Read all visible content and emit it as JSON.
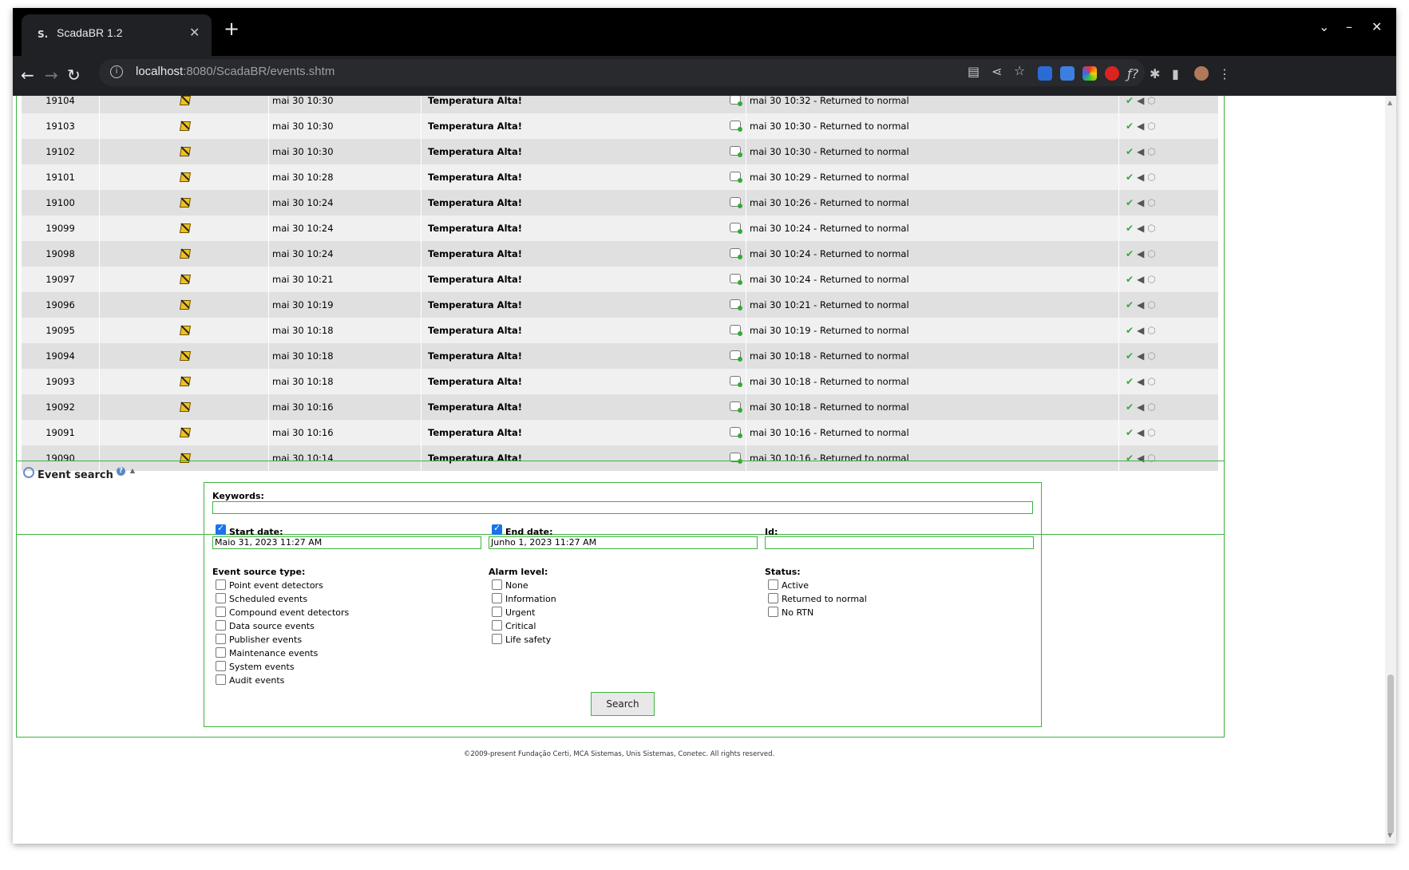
{
  "browser": {
    "tab_title": "ScadaBR 1.2",
    "tab_favicon": "S.",
    "url_host": "localhost",
    "url_path": ":8080/ScadaBR/events.shtm"
  },
  "events_table": {
    "rows": [
      {
        "id": "19104",
        "time": "mai 30 10:30",
        "message": "Temperatura Alta!",
        "rtn": "mai 30 10:32 - Returned to normal"
      },
      {
        "id": "19103",
        "time": "mai 30 10:30",
        "message": "Temperatura Alta!",
        "rtn": "mai 30 10:30 - Returned to normal"
      },
      {
        "id": "19102",
        "time": "mai 30 10:30",
        "message": "Temperatura Alta!",
        "rtn": "mai 30 10:30 - Returned to normal"
      },
      {
        "id": "19101",
        "time": "mai 30 10:28",
        "message": "Temperatura Alta!",
        "rtn": "mai 30 10:29 - Returned to normal"
      },
      {
        "id": "19100",
        "time": "mai 30 10:24",
        "message": "Temperatura Alta!",
        "rtn": "mai 30 10:26 - Returned to normal"
      },
      {
        "id": "19099",
        "time": "mai 30 10:24",
        "message": "Temperatura Alta!",
        "rtn": "mai 30 10:24 - Returned to normal"
      },
      {
        "id": "19098",
        "time": "mai 30 10:24",
        "message": "Temperatura Alta!",
        "rtn": "mai 30 10:24 - Returned to normal"
      },
      {
        "id": "19097",
        "time": "mai 30 10:21",
        "message": "Temperatura Alta!",
        "rtn": "mai 30 10:24 - Returned to normal"
      },
      {
        "id": "19096",
        "time": "mai 30 10:19",
        "message": "Temperatura Alta!",
        "rtn": "mai 30 10:21 - Returned to normal"
      },
      {
        "id": "19095",
        "time": "mai 30 10:18",
        "message": "Temperatura Alta!",
        "rtn": "mai 30 10:19 - Returned to normal"
      },
      {
        "id": "19094",
        "time": "mai 30 10:18",
        "message": "Temperatura Alta!",
        "rtn": "mai 30 10:18 - Returned to normal"
      },
      {
        "id": "19093",
        "time": "mai 30 10:18",
        "message": "Temperatura Alta!",
        "rtn": "mai 30 10:18 - Returned to normal"
      },
      {
        "id": "19092",
        "time": "mai 30 10:16",
        "message": "Temperatura Alta!",
        "rtn": "mai 30 10:18 - Returned to normal"
      },
      {
        "id": "19091",
        "time": "mai 30 10:16",
        "message": "Temperatura Alta!",
        "rtn": "mai 30 10:16 - Returned to normal"
      },
      {
        "id": "19090",
        "time": "mai 30 10:14",
        "message": "Temperatura Alta!",
        "rtn": "mai 30 10:16 - Returned to normal"
      }
    ]
  },
  "event_search": {
    "title": "Event search",
    "keywords_label": "Keywords:",
    "keywords_value": "",
    "start_date_label": "Start date:",
    "start_date_value": "Maio 31, 2023 11:27 AM",
    "end_date_label": "End date:",
    "end_date_value": "Junho 1, 2023 11:27 AM",
    "id_label": "Id:",
    "id_value": "",
    "source_type_label": "Event source type:",
    "source_types": [
      "Point event detectors",
      "Scheduled events",
      "Compound event detectors",
      "Data source events",
      "Publisher events",
      "Maintenance events",
      "System events",
      "Audit events"
    ],
    "alarm_level_label": "Alarm level:",
    "alarm_levels": [
      "None",
      "Information",
      "Urgent",
      "Critical",
      "Life safety"
    ],
    "status_label": "Status:",
    "statuses": [
      "Active",
      "Returned to normal",
      "No RTN"
    ],
    "search_button": "Search"
  },
  "footer": "©2009-present Fundação Certi, MCA Sistemas, Unis Sistemas, Conetec. All rights reserved."
}
